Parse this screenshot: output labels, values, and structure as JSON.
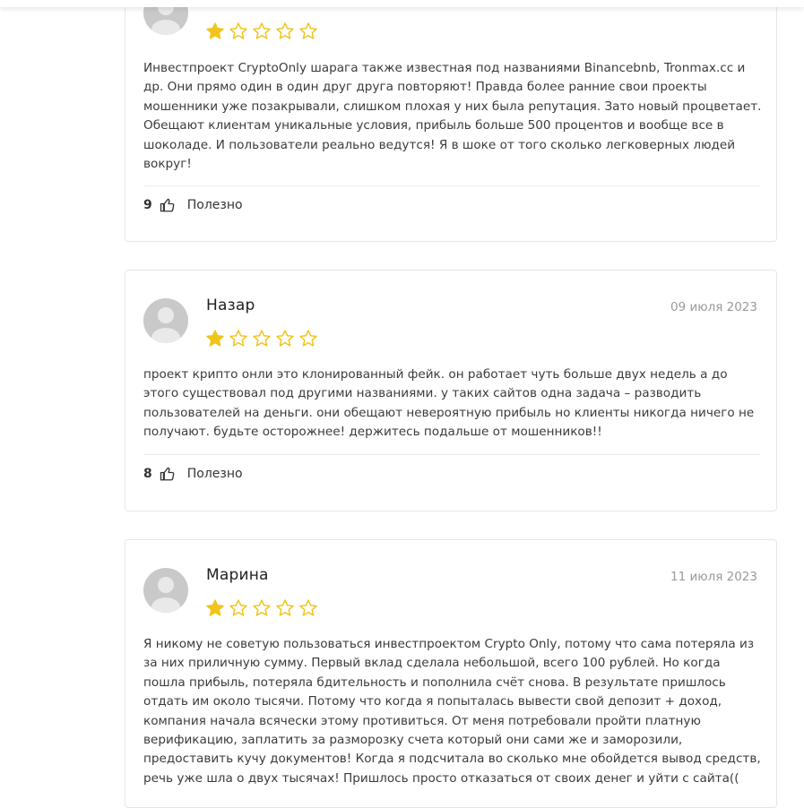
{
  "reviews": [
    {
      "author": "",
      "date": "",
      "rating": 1,
      "max_rating": 5,
      "text": "Инвестпроект CryptoOnly шарага также известная под названиями Binancebnb, Tronmax.cc и др. Они прямо один в один друг друга повторяют! Правда более ранние свои проекты мошенники уже позакрывали, слишком плохая у них была репутация. Зато новый процветает. Обещают клиентам уникальные условия, прибыль больше 500 процентов и вообще все в шоколаде. И пользователи реально ведутся! Я в шоке от того сколько легковерных людей вокруг!",
      "helpful_count": "9",
      "helpful_label": "Полезно"
    },
    {
      "author": "Назар",
      "date": "09 июля 2023",
      "rating": 1,
      "max_rating": 5,
      "text": "проект крипто онли это клонированный фейк. он работает чуть больше двух недель а до этого существовал под другими названиями. у таких сайтов одна задача – разводить пользователей на деньги. они обещают невероятную прибыль но клиенты никогда ничего не получают. будьте осторожнее! держитесь подальше от мошенников!!",
      "helpful_count": "8",
      "helpful_label": "Полезно"
    },
    {
      "author": "Марина",
      "date": "11 июля 2023",
      "rating": 1,
      "max_rating": 5,
      "text": "Я никому не советую пользоваться инвестпроектом Crypto Only, потому что сама потеряла из за них приличную сумму. Первый вклад сделала небольшой, всего 100 рублей. Но когда пошла прибыль, потеряла бдительность и пополнила счёт снова. В результате пришлось отдать им около тысячи. Потому что когда я попыталась вывести свой депозит + доход, компания начала всячески этому противиться. От меня потребовали пройти платную верификацию, заплатить за разморозку счета который они сами же и заморозили, предоставить кучу документов! Когда я подсчитала во сколько мне обойдется вывод средств, речь уже шла о двух тысячах! Пришлось просто отказаться от своих денег и уйти с сайта((",
      "helpful_count": "",
      "helpful_label": ""
    }
  ],
  "colors": {
    "star_filled": "#f0c419",
    "star_empty_stroke": "#f0c419",
    "avatar_bg": "#c9c9c9",
    "border": "#e6e6e6"
  },
  "icons": {
    "avatar": "user-avatar-placeholder",
    "star": "star-icon",
    "thumb": "thumbs-up-icon"
  }
}
